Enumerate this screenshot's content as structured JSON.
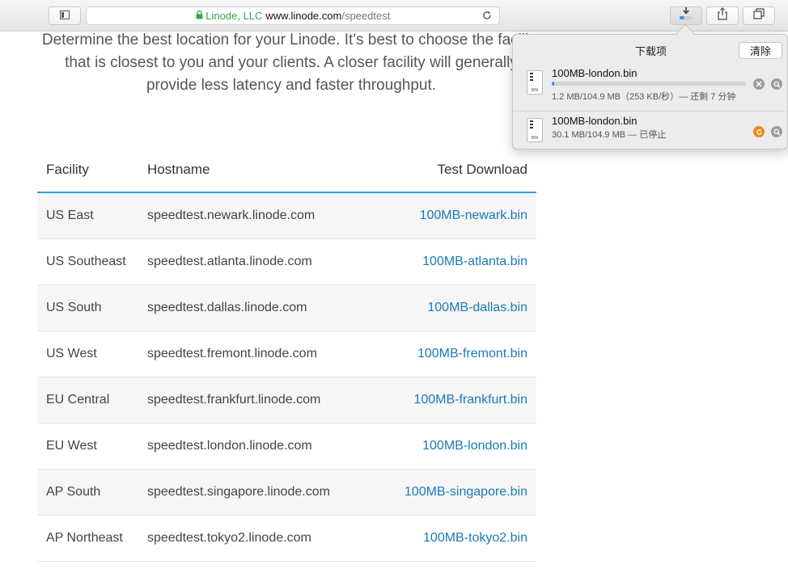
{
  "browser": {
    "url": {
      "secure_label": "Linode, LLC",
      "domain": "www.linode.com",
      "path": "/speedtest"
    },
    "icons": {
      "sidebar": "sidebar-icon",
      "reload": "reload-icon",
      "downloads": "download-icon",
      "share": "share-icon",
      "tabs": "tabs-icon"
    },
    "download_button_progress": 0.35
  },
  "page": {
    "intro_text": "Determine the best location for your Linode. It's best to choose the facility that is closest to you and your clients. A closer facility will generally provide less latency and faster throughput.",
    "table": {
      "headers": [
        "Facility",
        "Hostname",
        "Test Download"
      ],
      "rows": [
        {
          "facility": "US East",
          "hostname": "speedtest.newark.linode.com",
          "download": "100MB-newark.bin"
        },
        {
          "facility": "US Southeast",
          "hostname": "speedtest.atlanta.linode.com",
          "download": "100MB-atlanta.bin"
        },
        {
          "facility": "US South",
          "hostname": "speedtest.dallas.linode.com",
          "download": "100MB-dallas.bin"
        },
        {
          "facility": "US West",
          "hostname": "speedtest.fremont.linode.com",
          "download": "100MB-fremont.bin"
        },
        {
          "facility": "EU Central",
          "hostname": "speedtest.frankfurt.linode.com",
          "download": "100MB-frankfurt.bin"
        },
        {
          "facility": "EU West",
          "hostname": "speedtest.london.linode.com",
          "download": "100MB-london.bin"
        },
        {
          "facility": "AP South",
          "hostname": "speedtest.singapore.linode.com",
          "download": "100MB-singapore.bin"
        },
        {
          "facility": "AP Northeast",
          "hostname": "speedtest.tokyo2.linode.com",
          "download": "100MB-tokyo2.bin"
        }
      ]
    }
  },
  "downloads_popover": {
    "title": "下载项",
    "clear_label": "清除",
    "items": [
      {
        "name": "100MB-london.bin",
        "file_ext": "BIN",
        "status": "1.2 MB/104.9 MB（253 KB/秒）— 还剩 7 分钟",
        "progress": 0.011,
        "state": "downloading"
      },
      {
        "name": "100MB-london.bin",
        "file_ext": "BIN",
        "status": "30.1 MB/104.9 MB — 已停止",
        "progress": 0.287,
        "state": "stopped"
      }
    ]
  },
  "colors": {
    "accent": "#2d9fda",
    "link": "#1a7bb8",
    "secure": "#2fa84f",
    "resume": "#ef8a1f",
    "progress": "#3b8fe8"
  }
}
